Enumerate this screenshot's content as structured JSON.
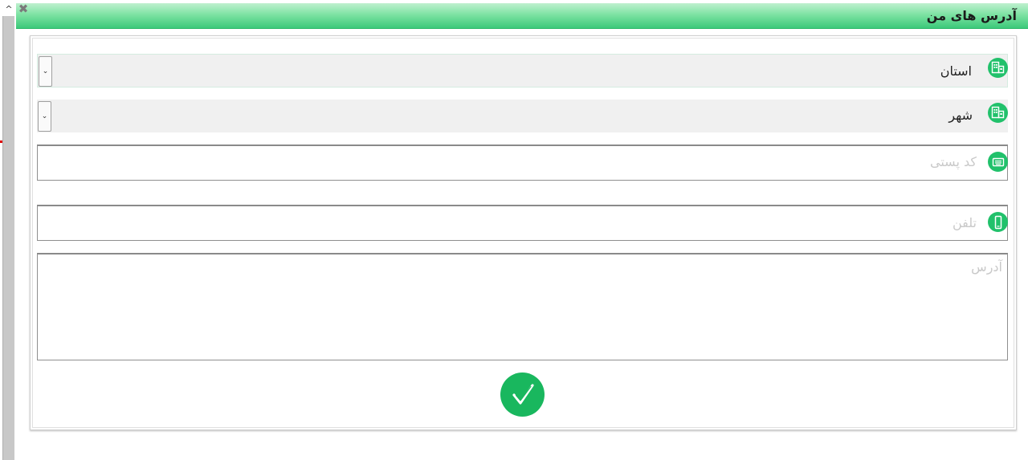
{
  "dialog": {
    "title": "آدرس های من",
    "close_icon": "close-icon"
  },
  "scrollbar": {
    "up_arrow": "^"
  },
  "form": {
    "province": {
      "label": "استان",
      "icon": "buildings-icon",
      "dropdown_glyph": "⌄"
    },
    "city": {
      "label": "شهر",
      "icon": "buildings-icon",
      "dropdown_glyph": "⌄"
    },
    "postal_code": {
      "placeholder": "کد پستی",
      "icon": "keyboard-icon"
    },
    "phone": {
      "placeholder": "تلفن",
      "icon": "mobile-phone-icon"
    },
    "address": {
      "placeholder": "آدرس"
    },
    "submit": {
      "icon": "checkmark-icon"
    }
  },
  "colors": {
    "accent": "#21c16b",
    "header_top": "#bff0cf",
    "header_bottom": "#3cc97a"
  }
}
